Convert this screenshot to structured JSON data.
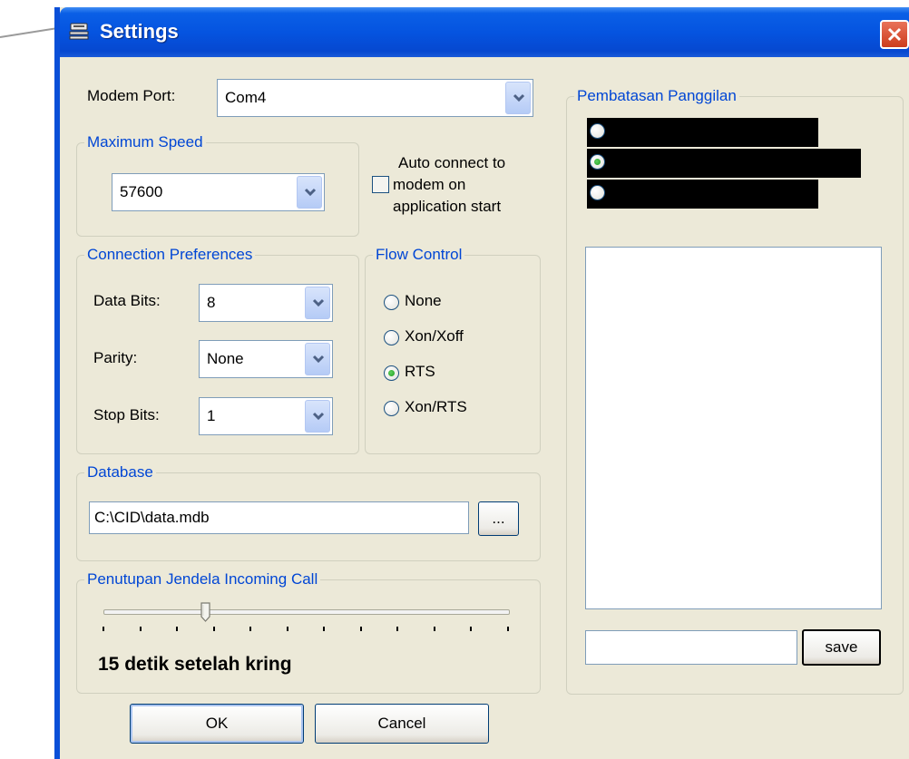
{
  "window": {
    "title": "Settings"
  },
  "modem_port": {
    "label": "Modem Port:",
    "value": "Com4"
  },
  "maximum_speed": {
    "title": "Maximum Speed",
    "value": "57600"
  },
  "auto_connect": {
    "label_lines": [
      "Auto connect to",
      "modem on",
      "application start"
    ],
    "checked": false
  },
  "connection_preferences": {
    "title": "Connection Preferences",
    "data_bits": {
      "label": "Data Bits:",
      "value": "8"
    },
    "parity": {
      "label": "Parity:",
      "value": "None"
    },
    "stop_bits": {
      "label": "Stop Bits:",
      "value": "1"
    }
  },
  "flow_control": {
    "title": "Flow Control",
    "options": [
      "None",
      "Xon/Xoff",
      "RTS",
      "Xon/RTS"
    ],
    "selected_index": 2
  },
  "database": {
    "title": "Database",
    "path": "C:\\CID\\data.mdb",
    "browse_label": "..."
  },
  "incoming_call": {
    "title": "Penutupan Jendela Incoming Call",
    "status": "15 detik setelah kring",
    "slider_fraction": 0.25,
    "tick_count": 12
  },
  "pembatasan_panggilan": {
    "title": "Pembatasan Panggilan",
    "selected_index": 1,
    "option_count": 3,
    "input_value": "",
    "save_label": "save"
  },
  "buttons": {
    "ok": "OK",
    "cancel": "Cancel"
  },
  "colors": {
    "title_bar": "#0554e0",
    "group_title": "#0046d5",
    "dialog_bg": "#ece9d8"
  }
}
